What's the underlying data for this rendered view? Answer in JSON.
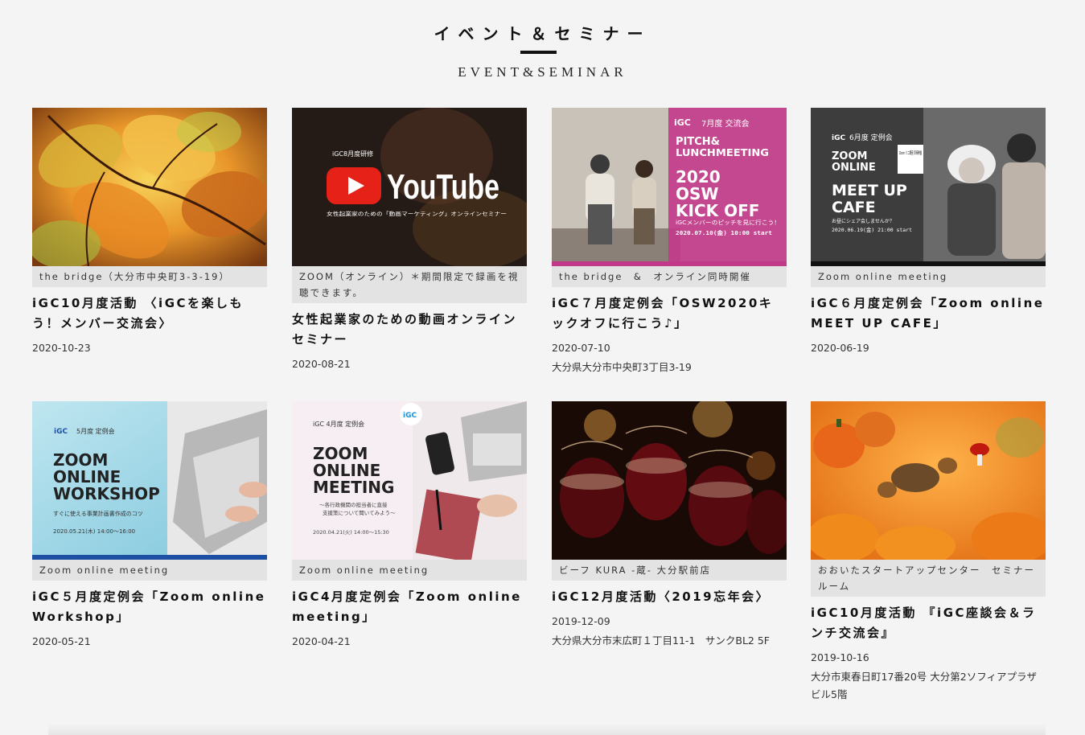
{
  "section": {
    "title_jp": "イベント＆セミナー",
    "title_en": "EVENT&SEMINAR"
  },
  "colors": {
    "background": "#f4f4f4",
    "venue_bg": "#e3e3e3",
    "accent_pink": "#c2398a",
    "accent_blue": "#1d4fa3"
  },
  "cards": [
    {
      "venue": "the bridge（大分市中央町3-3-19）",
      "title": "iGC10月度活動 〈iGCを楽しもう！メンバー交流会〉",
      "date": "2020-10-23",
      "address": "",
      "thumb_icon": "autumn-leaves-photo"
    },
    {
      "venue": "ZOOM（オンライン）＊期間限定で録画を視聴できます。",
      "title": "女性起業家のための動画オンラインセミナー",
      "date": "2020-08-21",
      "address": "",
      "thumb_icon": "youtube-seminar-banner",
      "thumb": {
        "label": "iGC8月度研修",
        "brand": "YouTube",
        "sub": "女性起業家のための「動画マーケティング」オンラインセミナー"
      }
    },
    {
      "venue": "the bridge　&　オンライン同時開催",
      "title": "iGC７月度定例会「OSW2020キックオフに行こう♪」",
      "date": "2020-07-10",
      "address": "大分県大分市中央町3丁目3-19",
      "thumb_icon": "osw-kickoff-banner",
      "thumb": {
        "logo": "iGC",
        "label": "7月度 交流会",
        "line1": "PITCH&",
        "line2": "LUNCHMEETING",
        "line3": "2020",
        "line4": "OSW",
        "line5": "KICK OFF",
        "sub": "iGCメンバーのピッチを見に行こう！",
        "when": "2020.07.10(金) 10:00 start"
      }
    },
    {
      "venue": "Zoom online meeting",
      "title": "iGC６月度定例会「Zoom online MEET UP CAFE」",
      "date": "2020-06-19",
      "address": "",
      "thumb_icon": "meetup-cafe-banner",
      "thumb": {
        "logo": "iGC",
        "label": "6月度 定例会",
        "line1": "ZOOM",
        "line2": "ONLINE",
        "line3": "MEET UP",
        "line4": "CAFE",
        "badge": "Zoom ミニ講座 同時開催",
        "sub": "お昼にシェア会しませんか？",
        "when": "2020.06.19(金) 21:00 start"
      }
    },
    {
      "venue": "Zoom online meeting",
      "title": "iGC５月度定例会「Zoom online Workshop」",
      "date": "2020-05-21",
      "address": "",
      "thumb_icon": "zoom-workshop-banner",
      "thumb": {
        "logo": "iGC",
        "label": "5月度 定例会",
        "line1": "ZOOM",
        "line2": "ONLINE",
        "line3": "WORKSHOP",
        "sub": "すぐに使える事業計画書作成のコツ",
        "when": "2020.05.21(木) 14:00〜16:00"
      }
    },
    {
      "venue": "Zoom online meeting",
      "title": "iGC4月度定例会「Zoom online meeting」",
      "date": "2020-04-21",
      "address": "",
      "thumb_icon": "zoom-meeting-banner",
      "thumb": {
        "logo": "iGC",
        "label": "iGC 4月度 定例会",
        "line1": "ZOOM",
        "line2": "ONLINE",
        "line3": "MEETING",
        "sub1": "〜各行政機関の担当者に直接",
        "sub2": "支援策について聞いてみよう〜",
        "when": "2020.04.21(火) 14:00〜15:30"
      }
    },
    {
      "venue": "ビーフ KURA -蔵- 大分駅前店",
      "title": "iGC12月度活動〈2019忘年会〉",
      "date": "2019-12-09",
      "address": "大分県大分市末広町１丁目11-1　サンクBL2 5F",
      "thumb_icon": "wine-glasses-photo"
    },
    {
      "venue": "おおいたスタートアップセンター　セミナールーム",
      "title": "iGC10月度活動 『iGC座談会＆ランチ交流会』",
      "date": "2019-10-16",
      "address": "大分市東春日町17番20号 大分第2ソフィアプラザビル5階",
      "thumb_icon": "autumn-pumpkins-photo"
    }
  ]
}
